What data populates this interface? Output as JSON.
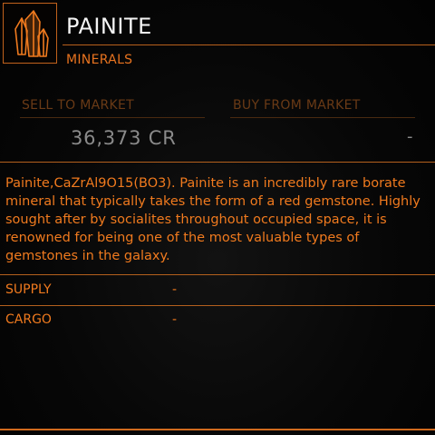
{
  "item": {
    "icon": "crystal-icon",
    "name": "PAINITE",
    "category": "MINERALS"
  },
  "market": {
    "sell_label": "SELL TO MARKET",
    "buy_label": "BUY FROM MARKET",
    "sell_value": "36,373 CR",
    "buy_value": "-"
  },
  "description": "Painite,CaZrAl9O15(BO3). Painite is an incredibly rare borate mineral that typically takes the form of a red gemstone. Highly sought after by socialites throughout occupied space, it is renowned for being one of the most valuable types of gemstones in the galaxy.",
  "details": {
    "supply_label": "SUPPLY",
    "supply_value": "-",
    "cargo_label": "CARGO",
    "cargo_value": "-"
  },
  "colors": {
    "accent": "#f07a1e",
    "title": "#f4f4f4",
    "value": "#8a8a8a",
    "dim_label": "#6a3a16"
  }
}
